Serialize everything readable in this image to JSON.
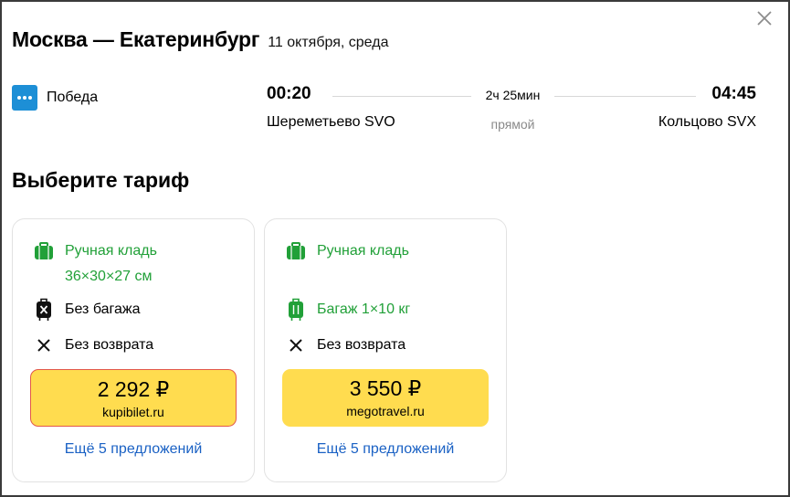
{
  "header": {
    "title": "Москва — Екатеринбург",
    "date": "11 октября, среда"
  },
  "flight": {
    "airline": "Победа",
    "departure_time": "00:20",
    "arrival_time": "04:45",
    "duration": "2ч 25мин",
    "type": "прямой",
    "departure_airport": "Шереметьево SVO",
    "arrival_airport": "Кольцово SVX"
  },
  "section_title": "Выберите тариф",
  "tariffs": [
    {
      "hand_luggage": "Ручная кладь",
      "hand_luggage_size": "36×30×27 см",
      "baggage": "Без багажа",
      "refund": "Без возврата",
      "price": "2 292 ₽",
      "vendor": "kupibilet.ru",
      "more_offers": "Ещё 5 предложений"
    },
    {
      "hand_luggage": "Ручная кладь",
      "baggage": "Багаж 1×10 кг",
      "refund": "Без возврата",
      "price": "3 550 ₽",
      "vendor": "megotravel.ru",
      "more_offers": "Ещё 5 предложений"
    }
  ],
  "colors": {
    "accent_yellow": "#ffdc4f",
    "included_green": "#21a038",
    "link_blue": "#1a61c4",
    "airline_blue": "#1d8fd6",
    "selected_border": "#e2584a"
  },
  "icons": {
    "close": "close-icon",
    "airline": "pobeda-logo",
    "hand_luggage": "bag-icon",
    "no_baggage": "suitcase-crossed-icon",
    "baggage": "suitcase-icon",
    "no_refund": "cross-icon"
  }
}
